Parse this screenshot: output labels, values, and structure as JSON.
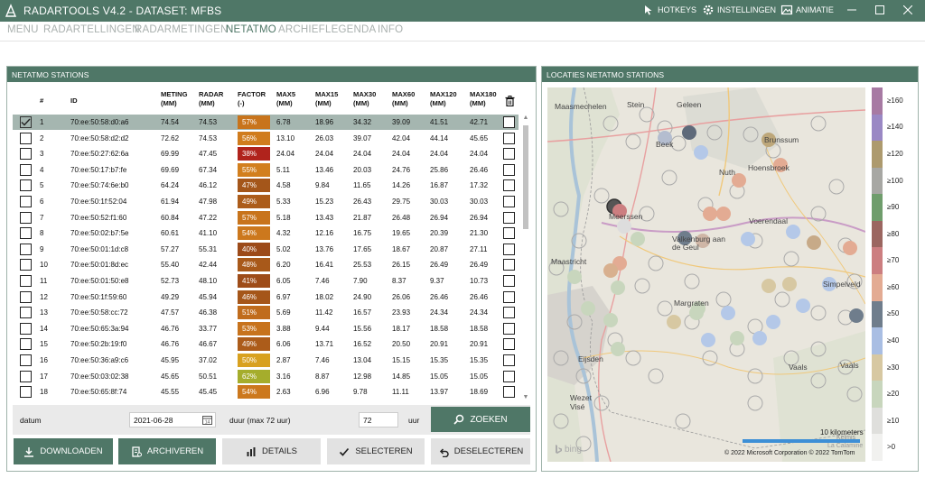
{
  "titlebar": {
    "title": "RADARTOOLS V4.2 - DATASET: MFBS",
    "hotkeys": "HOTKEYS",
    "settings": "INSTELLINGEN",
    "animation": "ANIMATIE"
  },
  "menu": [
    "MENU",
    "RADARTELLINGEN",
    "RADARMETINGEN",
    "NETATMO",
    "ARCHIEF",
    "LEGENDA",
    "INFO"
  ],
  "active_menu": "NETATMO",
  "stations_panel": {
    "title": "NETATMO STATIONS",
    "columns": {
      "num": "#",
      "id": "ID",
      "meting": "METING\n(MM)",
      "radar": "RADAR\n(MM)",
      "factor": "FACTOR\n(-)",
      "max5": "MAX5\n(MM)",
      "max15": "MAX15\n(MM)",
      "max30": "MAX30\n(MM)",
      "max60": "MAX60\n(MM)",
      "max120": "MAX120\n(MM)",
      "max180": "MAX180\n(MM)"
    },
    "rows": [
      {
        "n": "1",
        "id": "70:ee:50:58:d0:a6",
        "meting": "74.54",
        "radar": "74.53",
        "factor": "57%",
        "fcolor": "#c8741c",
        "max5": "6.78",
        "max15": "18.96",
        "max30": "34.32",
        "max60": "39.09",
        "max120": "41.51",
        "max180": "42.71",
        "checked": true
      },
      {
        "n": "2",
        "id": "70:ee:50:58:d2:d2",
        "meting": "72.62",
        "radar": "74.53",
        "factor": "56%",
        "fcolor": "#d07c1d",
        "max5": "13.10",
        "max15": "26.03",
        "max30": "39.07",
        "max60": "42.04",
        "max120": "44.14",
        "max180": "45.65",
        "checked": false
      },
      {
        "n": "3",
        "id": "70:ee:50:27:62:6a",
        "meting": "69.99",
        "radar": "47.45",
        "factor": "38%",
        "fcolor": "#b0231c",
        "max5": "24.04",
        "max15": "24.04",
        "max30": "24.04",
        "max60": "24.04",
        "max120": "24.04",
        "max180": "24.04",
        "checked": false
      },
      {
        "n": "4",
        "id": "70:ee:50:17:b7:fe",
        "meting": "69.69",
        "radar": "67.34",
        "factor": "55%",
        "fcolor": "#d27f1e",
        "max5": "5.11",
        "max15": "13.46",
        "max30": "20.03",
        "max60": "24.76",
        "max120": "25.86",
        "max180": "26.46",
        "checked": false
      },
      {
        "n": "5",
        "id": "70:ee:50:74:6e:b0",
        "meting": "64.24",
        "radar": "46.12",
        "factor": "47%",
        "fcolor": "#a4561a",
        "max5": "4.58",
        "max15": "9.84",
        "max30": "11.65",
        "max60": "14.26",
        "max120": "16.87",
        "max180": "17.32",
        "checked": false
      },
      {
        "n": "6",
        "id": "70:ee:50:1f:52:04",
        "meting": "61.94",
        "radar": "47.98",
        "factor": "49%",
        "fcolor": "#ac5c1a",
        "max5": "5.33",
        "max15": "15.23",
        "max30": "26.43",
        "max60": "29.75",
        "max120": "30.03",
        "max180": "30.03",
        "checked": false
      },
      {
        "n": "7",
        "id": "70:ee:50:52:f1:60",
        "meting": "60.84",
        "radar": "47.22",
        "factor": "57%",
        "fcolor": "#c8741c",
        "max5": "5.18",
        "max15": "13.43",
        "max30": "21.87",
        "max60": "26.48",
        "max120": "26.94",
        "max180": "26.94",
        "checked": false
      },
      {
        "n": "8",
        "id": "70:ee:50:02:b7:5e",
        "meting": "60.61",
        "radar": "41.10",
        "factor": "54%",
        "fcolor": "#cc781d",
        "max5": "4.32",
        "max15": "12.16",
        "max30": "16.75",
        "max60": "19.65",
        "max120": "20.39",
        "max180": "21.30",
        "checked": false
      },
      {
        "n": "9",
        "id": "70:ee:50:01:1d:c8",
        "meting": "57.27",
        "radar": "55.31",
        "factor": "40%",
        "fcolor": "#9c4a19",
        "max5": "5.02",
        "max15": "13.76",
        "max30": "17.65",
        "max60": "18.67",
        "max120": "20.87",
        "max180": "27.11",
        "checked": false
      },
      {
        "n": "10",
        "id": "70:ee:50:01:8d:ec",
        "meting": "55.40",
        "radar": "42.44",
        "factor": "48%",
        "fcolor": "#a8591a",
        "max5": "6.20",
        "max15": "16.41",
        "max30": "25.53",
        "max60": "26.15",
        "max120": "26.49",
        "max180": "26.49",
        "checked": false
      },
      {
        "n": "11",
        "id": "70:ee:50:01:50:e8",
        "meting": "52.73",
        "radar": "48.10",
        "factor": "41%",
        "fcolor": "#9e4c19",
        "max5": "6.05",
        "max15": "7.46",
        "max30": "7.90",
        "max60": "8.37",
        "max120": "9.37",
        "max180": "10.73",
        "checked": false
      },
      {
        "n": "12",
        "id": "70:ee:50:1f:59:60",
        "meting": "49.29",
        "radar": "45.94",
        "factor": "46%",
        "fcolor": "#a55619",
        "max5": "6.97",
        "max15": "18.02",
        "max30": "24.90",
        "max60": "26.06",
        "max120": "26.46",
        "max180": "26.46",
        "checked": false
      },
      {
        "n": "13",
        "id": "70:ee:50:58:cc:72",
        "meting": "47.57",
        "radar": "46.38",
        "factor": "51%",
        "fcolor": "#c06c1c",
        "max5": "5.69",
        "max15": "11.42",
        "max30": "16.57",
        "max60": "23.93",
        "max120": "24.34",
        "max180": "24.34",
        "checked": false
      },
      {
        "n": "14",
        "id": "70:ee:50:65:3a:94",
        "meting": "46.76",
        "radar": "33.77",
        "factor": "53%",
        "fcolor": "#c7731d",
        "max5": "3.88",
        "max15": "9.44",
        "max30": "15.56",
        "max60": "18.17",
        "max120": "18.58",
        "max180": "18.58",
        "checked": false
      },
      {
        "n": "15",
        "id": "70:ee:50:2b:19:f0",
        "meting": "46.76",
        "radar": "46.67",
        "factor": "49%",
        "fcolor": "#ac5c1a",
        "max5": "6.06",
        "max15": "13.71",
        "max30": "16.52",
        "max60": "20.50",
        "max120": "20.91",
        "max180": "20.91",
        "checked": false
      },
      {
        "n": "16",
        "id": "70:ee:50:36:a9:c6",
        "meting": "45.95",
        "radar": "37.02",
        "factor": "50%",
        "fcolor": "#d8a11f",
        "max5": "2.87",
        "max15": "7.46",
        "max30": "13.04",
        "max60": "15.15",
        "max120": "15.35",
        "max180": "15.35",
        "checked": false
      },
      {
        "n": "17",
        "id": "70:ee:50:03:02:38",
        "meting": "45.65",
        "radar": "50.51",
        "factor": "62%",
        "fcolor": "#a5ad2c",
        "max5": "3.16",
        "max15": "8.87",
        "max30": "12.98",
        "max60": "14.85",
        "max120": "15.05",
        "max180": "15.05",
        "checked": false
      },
      {
        "n": "18",
        "id": "70:ee:50:65:8f:74",
        "meting": "45.55",
        "radar": "45.45",
        "factor": "54%",
        "fcolor": "#cc781d",
        "max5": "2.63",
        "max15": "6.96",
        "max30": "9.78",
        "max60": "11.11",
        "max120": "13.97",
        "max180": "18.69",
        "checked": false
      }
    ]
  },
  "controls": {
    "datum_label": "datum",
    "datum_value": "2021-06-28",
    "duur_label": "duur (max 72 uur)",
    "duur_value": "72",
    "uur_label": "uur",
    "zoeken": "ZOEKEN"
  },
  "buttons": {
    "download": "DOWNLOADEN",
    "archive": "ARCHIVEREN",
    "details": "DETAILS",
    "select": "SELECTEREN",
    "deselect": "DESELECTEREN"
  },
  "map_panel": {
    "title": "LOCATIES NETATMO STATIONS",
    "places": [
      "Maasmechelen",
      "Stein",
      "Geleen",
      "Beek",
      "Brunssum",
      "Nuth",
      "Hoensbroek",
      "Meerssen",
      "Voerendaal",
      "Valkenburg aan de Geul",
      "Maastricht",
      "Margraten",
      "Simpelveld",
      "Eijsden",
      "Vaals",
      "Vaals",
      "Wezet",
      "Visé",
      "Kelmis",
      "La Calamine"
    ],
    "scale": "10 kilometers",
    "copyright": "© 2022 Microsoft Corporation  © 2022 TomTom",
    "bing": "bing",
    "legend": [
      {
        "label": "≥160",
        "color": "#a77aa3"
      },
      {
        "label": "≥140",
        "color": "#9a88c4"
      },
      {
        "label": "≥120",
        "color": "#ad9a6e"
      },
      {
        "label": "≥100",
        "color": "#a7a7a3"
      },
      {
        "label": "≥90",
        "color": "#6f9d6c"
      },
      {
        "label": "≥80",
        "color": "#9b6660"
      },
      {
        "label": "≥70",
        "color": "#cc7e80"
      },
      {
        "label": "≥60",
        "color": "#e3ab93"
      },
      {
        "label": "≥50",
        "color": "#6f7d8c"
      },
      {
        "label": "≥40",
        "color": "#a9bee3"
      },
      {
        "label": "≥30",
        "color": "#d7c8a2"
      },
      {
        "label": "≥20",
        "color": "#c8d6bd"
      },
      {
        "label": "≥10",
        "color": "#dfdfdc"
      },
      {
        "label": ">0",
        "color": "#f1f1ef"
      }
    ]
  }
}
